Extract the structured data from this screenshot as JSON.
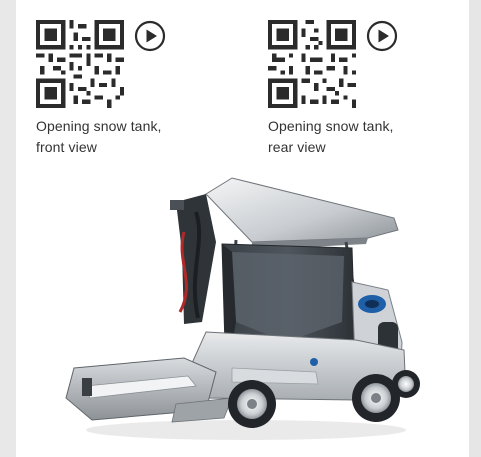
{
  "qr_codes": [
    {
      "caption_line1": "Opening snow tank,",
      "caption_line2": "front view",
      "icon": "qr-code-icon",
      "action_icon": "play-icon"
    },
    {
      "caption_line1": "Opening snow tank,",
      "caption_line2": "rear view",
      "icon": "qr-code-icon",
      "action_icon": "play-icon"
    }
  ],
  "product_image": {
    "subject": "sweeper-vehicle"
  },
  "colors": {
    "background": "#e9e9e9",
    "card": "#ffffff",
    "text": "#333333",
    "accent": "#1f5fa8"
  }
}
